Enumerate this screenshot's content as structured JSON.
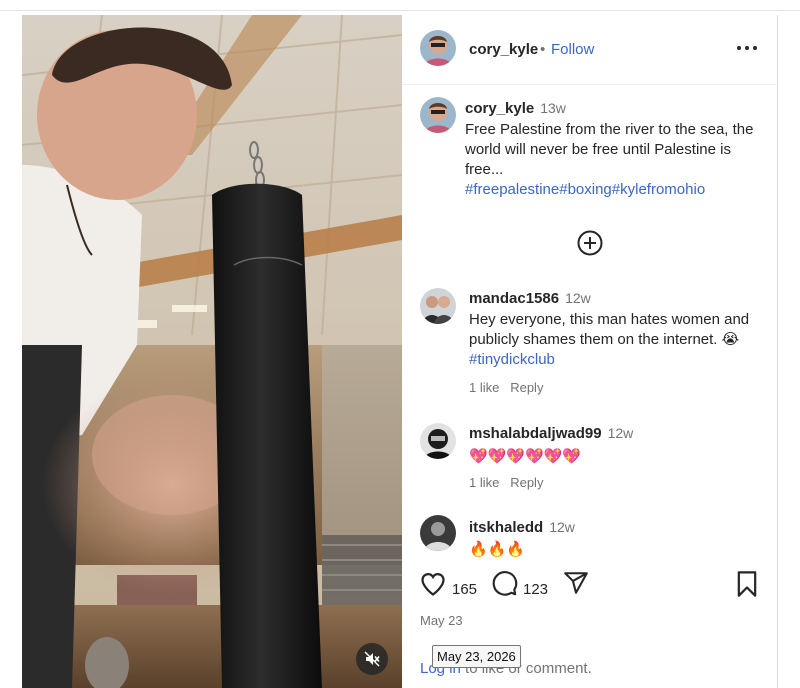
{
  "post": {
    "author": "cory_kyle",
    "follow_label": "Follow",
    "separator": "•",
    "caption_time": "13w",
    "caption_text": "Free Palestine from the river to the sea, the world will never be free until Palestine is free...",
    "hashtags": [
      "#freepalestine",
      "#boxing",
      "#kylefromohio"
    ],
    "likes": "165",
    "comment_count": "123",
    "date": "May 23",
    "date_tooltip": "May 23, 2026",
    "login_prompt": {
      "link": "Log in",
      "rest": " to like or comment."
    }
  },
  "comments": [
    {
      "user": "mandac1586",
      "time": "12w",
      "text": "Hey everyone, this man hates women and publicly shames them on the internet. 😭",
      "tag": "#tinydickclub",
      "likes": "1 like",
      "reply": "Reply"
    },
    {
      "user": "mshalabdaljwad99",
      "time": "12w",
      "text": "💖💖💖💖💖💖",
      "likes": "1 like",
      "reply": "Reply"
    },
    {
      "user": "itskhaledd",
      "time": "12w",
      "text": "🔥🔥🔥"
    }
  ],
  "icons": {
    "more": "more-options-icon",
    "add_comment": "add-circle-icon",
    "like": "heart-icon",
    "comment": "comment-bubble-icon",
    "share": "send-icon",
    "save": "bookmark-icon",
    "mute": "speaker-muted-icon"
  },
  "colors": {
    "link_blue": "#3b66c4",
    "muted_text": "#737373",
    "text": "#262626"
  }
}
